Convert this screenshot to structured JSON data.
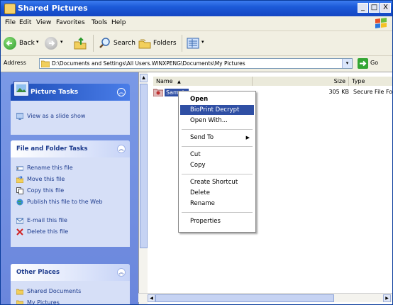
{
  "window": {
    "title": "Shared Pictures",
    "controls": {
      "minimize": "_",
      "maximize": "□",
      "close": "X"
    }
  },
  "menubar": {
    "items": [
      "File",
      "Edit",
      "View",
      "Favorites",
      "Tools",
      "Help"
    ]
  },
  "toolbar": {
    "back_label": "Back",
    "search_label": "Search",
    "folders_label": "Folders"
  },
  "address": {
    "label": "Address",
    "value": "D:\\Documents and Settings\\All Users.WINXPENG\\Documents\\My Pictures",
    "go_label": "Go"
  },
  "left_pane": {
    "picture_tasks": {
      "title": "Picture Tasks",
      "items": [
        "View as a slide show"
      ]
    },
    "file_folder_tasks": {
      "title": "File and Folder Tasks",
      "items": [
        "Rename this file",
        "Move this file",
        "Copy this file",
        "Publish this file to the Web",
        "E-mail this file",
        "Delete this file"
      ]
    },
    "other_places": {
      "title": "Other Places",
      "items": [
        "Shared Documents",
        "My Pictures"
      ]
    }
  },
  "file_list": {
    "columns": [
      "Name",
      "Size",
      "Type"
    ],
    "rows": [
      {
        "name": "Sample",
        "size": "305 KB",
        "type": "Secure File Folder"
      }
    ]
  },
  "context_menu": {
    "items": [
      "Open",
      "BioPrint Decrypt",
      "Open With...",
      "Send To",
      "Cut",
      "Copy",
      "Create Shortcut",
      "Delete",
      "Rename",
      "Properties"
    ],
    "default_item": "Open",
    "highlighted_item": "BioPrint Decrypt"
  },
  "colors": {
    "titlebar": "#1c5ad8",
    "left_pane": "#6a86dc",
    "panel_body": "#d6dff7",
    "highlight": "#2f4fa4",
    "link_text": "#1c3a8c"
  }
}
